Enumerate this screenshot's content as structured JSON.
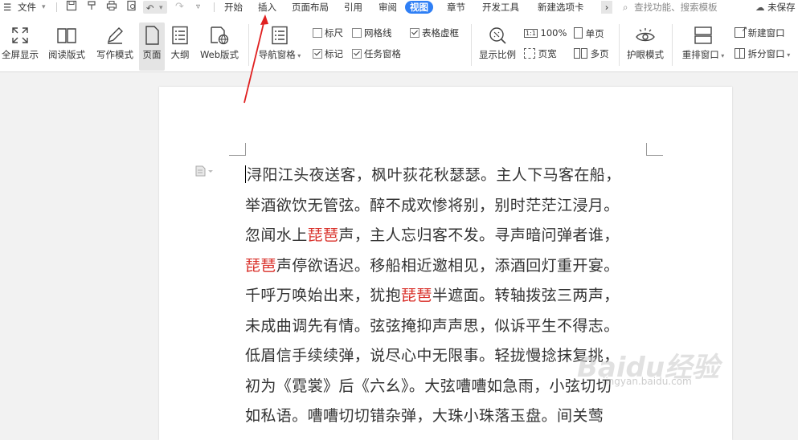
{
  "menubar": {
    "file_label": "文件",
    "tabs": [
      "开始",
      "插入",
      "页面布局",
      "引用",
      "审阅",
      "视图",
      "章节",
      "开发工具",
      "新建选项卡"
    ],
    "active_tab": "视图",
    "search_placeholder": "查找功能、搜索模板",
    "unsaved_label": "未保存"
  },
  "ribbon": {
    "fullscreen": "全屏显示",
    "reading": "阅读版式",
    "writing": "写作模式",
    "page": "页面",
    "outline": "大纲",
    "web": "Web版式",
    "nav_pane": "导航窗格",
    "ruler": "标尺",
    "gridlines": "网格线",
    "table_gridlines": "表格虚框",
    "marks": "标记",
    "task_pane": "任务窗格",
    "zoom_ratio": "显示比例",
    "zoom_100": "100%",
    "single_page": "单页",
    "page_width": "页宽",
    "multi_page": "多页",
    "eye_protect": "护眼模式",
    "rearrange": "重排窗口",
    "new_window": "新建窗口",
    "split_window": "拆分窗口"
  },
  "checkbox_state": {
    "ruler": false,
    "gridlines": false,
    "table_gridlines": true,
    "marks": true,
    "task_pane": true
  },
  "document": {
    "lines": [
      [
        {
          "t": "浔阳江头夜送客，枫叶荻花秋瑟瑟。主人下马客在船，"
        }
      ],
      [
        {
          "t": "举酒欲饮无管弦。醉不成欢惨将别，别时茫茫江浸月。"
        }
      ],
      [
        {
          "t": "忽闻水上"
        },
        {
          "t": "琵琶",
          "red": true
        },
        {
          "t": "声，主人忘归客不发。寻声暗问弹者谁，"
        }
      ],
      [
        {
          "t": "琵琶",
          "red": true
        },
        {
          "t": "声停欲语迟。移船相近邀相见，添酒回灯重开宴。"
        }
      ],
      [
        {
          "t": "千呼万唤始出来，犹抱"
        },
        {
          "t": "琵琶",
          "red": true
        },
        {
          "t": "半遮面。转轴拨弦三两声，"
        }
      ],
      [
        {
          "t": "未成曲调先有情。弦弦掩抑声声思，似诉平生不得志。"
        }
      ],
      [
        {
          "t": "低眉信手续续弹，说尽心中无限事。轻拢慢捻抹复挑，"
        }
      ],
      [
        {
          "t": "初为《霓裳》后《六幺》。大弦嘈嘈如急雨，小弦切切"
        }
      ],
      [
        {
          "t": "如私语。嘈嘈切切错杂弹，大珠小珠落玉盘。间关莺"
        }
      ]
    ]
  },
  "watermark": {
    "logo": "Baidu经验",
    "url": "jingyan.baidu.com"
  },
  "colors": {
    "accent": "#2f7ff5",
    "annotation_arrow": "#e02020",
    "highlight": "#d9302a"
  }
}
